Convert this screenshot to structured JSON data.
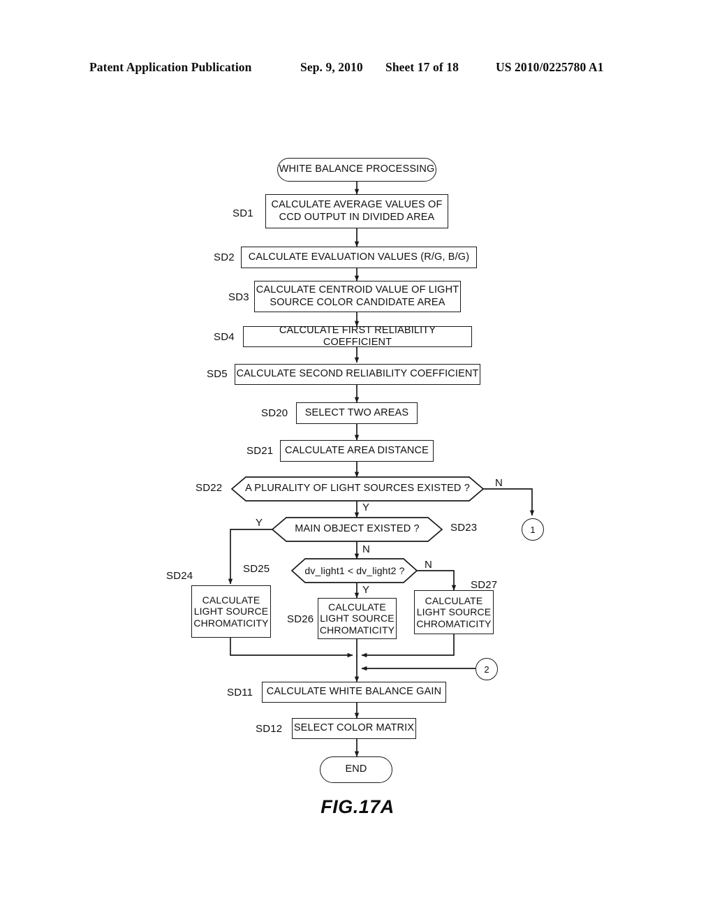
{
  "header": {
    "publication": "Patent Application Publication",
    "date": "Sep. 9, 2010",
    "sheet": "Sheet 17 of 18",
    "patent_number": "US 2010/0225780 A1"
  },
  "figure": {
    "caption": "FIG.17A"
  },
  "flowchart": {
    "start": {
      "label": "WHITE BALANCE PROCESSING"
    },
    "end": {
      "label": "END"
    },
    "nodes": [
      {
        "id": "SD1",
        "step": "SD1",
        "text": "CALCULATE AVERAGE VALUES OF\nCCD OUTPUT IN DIVIDED AREA",
        "type": "process"
      },
      {
        "id": "SD2",
        "step": "SD2",
        "text": "CALCULATE EVALUATION VALUES (R/G, B/G)",
        "type": "process"
      },
      {
        "id": "SD3",
        "step": "SD3",
        "text": "CALCULATE CENTROID VALUE OF LIGHT\nSOURCE COLOR CANDIDATE AREA",
        "type": "process"
      },
      {
        "id": "SD4",
        "step": "SD4",
        "text": "CALCULATE FIRST RELIABILITY COEFFICIENT",
        "type": "process"
      },
      {
        "id": "SD5",
        "step": "SD5",
        "text": "CALCULATE SECOND RELIABILITY COEFFICIENT",
        "type": "process"
      },
      {
        "id": "SD20",
        "step": "SD20",
        "text": "SELECT TWO AREAS",
        "type": "process"
      },
      {
        "id": "SD21",
        "step": "SD21",
        "text": "CALCULATE AREA DISTANCE",
        "type": "process"
      },
      {
        "id": "SD22",
        "step": "SD22",
        "text": "A PLURALITY OF LIGHT SOURCES EXISTED ?",
        "type": "decision"
      },
      {
        "id": "SD23",
        "step": "SD23",
        "text": "MAIN OBJECT EXISTED ?",
        "type": "decision"
      },
      {
        "id": "SD25",
        "step": "SD25",
        "text": "dv_light1 < dv_light2 ?",
        "type": "decision"
      },
      {
        "id": "SD24",
        "step": "SD24",
        "text": "CALCULATE\nLIGHT SOURCE\nCHROMATICITY",
        "type": "process"
      },
      {
        "id": "SD26",
        "step": "SD26",
        "text": "CALCULATE\nLIGHT SOURCE\nCHROMATICITY",
        "type": "process"
      },
      {
        "id": "SD27",
        "step": "SD27",
        "text": "CALCULATE\nLIGHT SOURCE\nCHROMATICITY",
        "type": "process"
      },
      {
        "id": "SD11",
        "step": "SD11",
        "text": "CALCULATE WHITE BALANCE GAIN",
        "type": "process"
      },
      {
        "id": "SD12",
        "step": "SD12",
        "text": "SELECT COLOR MATRIX",
        "type": "process"
      }
    ],
    "branch_labels": {
      "sd22_no": "N",
      "sd22_yes": "Y",
      "sd23_yes": "Y",
      "sd23_no": "N",
      "sd25_no": "N",
      "sd25_yes": "Y"
    },
    "connectors": [
      {
        "id": "conn-1",
        "label": "1"
      },
      {
        "id": "conn-2",
        "label": "2"
      }
    ]
  },
  "colors": {
    "ink": "#111111",
    "page": "#ffffff"
  }
}
